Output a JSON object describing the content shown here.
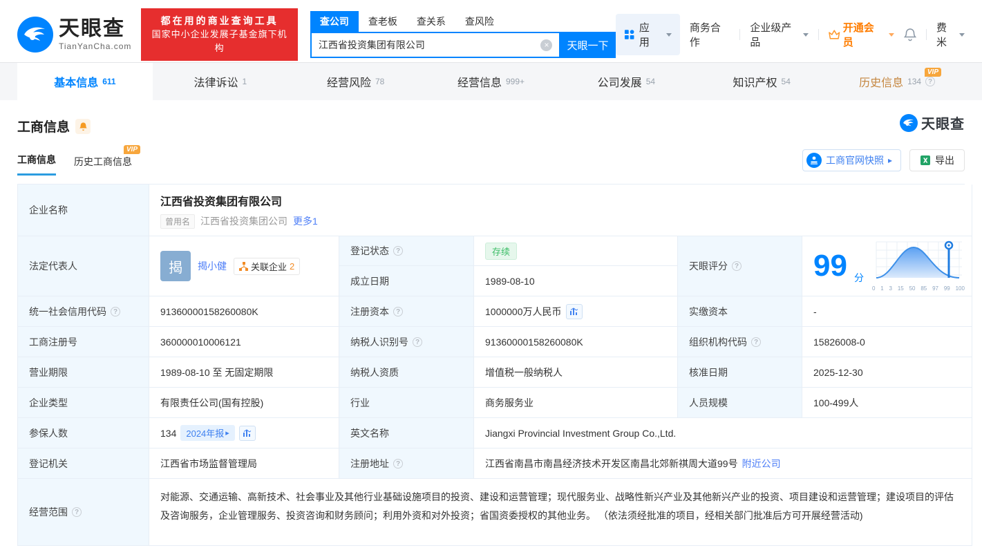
{
  "badges": {
    "vip": "VIP"
  },
  "colors": {
    "brand_blue": "#0084ff",
    "link_blue": "#4d7ef7",
    "member_orange": "#ff7d00",
    "promo_red": "#e62e2e",
    "status_green": "#3dbe68",
    "history_tab_orange": "#c5863f",
    "label_cell_bg": "#f0f8fe"
  },
  "header": {
    "logo": {
      "brand": "天眼查",
      "domain": "TianYanCha.com"
    },
    "promo": {
      "line1": "都在用的商业查询工具",
      "line2": "国家中小企业发展子基金旗下机构"
    },
    "search": {
      "tabs": [
        {
          "label": "查公司"
        },
        {
          "label": "查老板"
        },
        {
          "label": "查关系"
        },
        {
          "label": "查风险"
        }
      ],
      "value": "江西省投资集团有限公司",
      "button": "天眼一下"
    },
    "nav": {
      "apps": "应用",
      "cooperation": "商务合作",
      "enterprise": "企业级产品",
      "member": "开通会员",
      "user": "费米"
    }
  },
  "tabs": [
    {
      "label": "基本信息",
      "count": "611"
    },
    {
      "label": "法律诉讼",
      "count": "1"
    },
    {
      "label": "经营风险",
      "count": "78"
    },
    {
      "label": "经营信息",
      "count": "999+"
    },
    {
      "label": "公司发展",
      "count": "54"
    },
    {
      "label": "知识产权",
      "count": "54"
    },
    {
      "label": "历史信息",
      "count": "134"
    }
  ],
  "section": {
    "title": "工商信息",
    "watermark": "天眼查",
    "subtabs": [
      {
        "label": "工商信息"
      },
      {
        "label": "历史工商信息"
      }
    ],
    "snapshot_button": "工商官网快照",
    "export_button": "导出"
  },
  "table": {
    "company_name": {
      "label": "企业名称",
      "value": "江西省投资集团有限公司",
      "former_label": "曾用名",
      "former_value": "江西省投资集团公司",
      "more_link": "更多1"
    },
    "legal_rep": {
      "label": "法定代表人",
      "avatar_char": "揭",
      "name": "揭小健",
      "related_label": "关联企业",
      "related_count": "2"
    },
    "reg_status": {
      "label": "登记状态",
      "value": "存续"
    },
    "establish_date": {
      "label": "成立日期",
      "value": "1989-08-10"
    },
    "score": {
      "label": "天眼评分",
      "value": "99",
      "unit": "分",
      "axis": [
        "0",
        "1",
        "3",
        "15",
        "50",
        "85",
        "97",
        "99",
        "100"
      ]
    },
    "credit_code": {
      "label": "统一社会信用代码",
      "value": "91360000158260080K"
    },
    "reg_capital": {
      "label": "注册资本",
      "value": "1000000万人民币"
    },
    "paid_capital": {
      "label": "实缴资本",
      "value": "-"
    },
    "reg_number": {
      "label": "工商注册号",
      "value": "360000010006121"
    },
    "taxpayer_id": {
      "label": "纳税人识别号",
      "value": "91360000158260080K"
    },
    "org_code": {
      "label": "组织机构代码",
      "value": "15826008-0"
    },
    "business_term": {
      "label": "营业期限",
      "value": "1989-08-10 至 无固定期限"
    },
    "taxpayer_quality": {
      "label": "纳税人资质",
      "value": "增值税一般纳税人"
    },
    "approve_date": {
      "label": "核准日期",
      "value": "2025-12-30"
    },
    "company_type": {
      "label": "企业类型",
      "value": "有限责任公司(国有控股)"
    },
    "industry": {
      "label": "行业",
      "value": "商务服务业"
    },
    "staff_size": {
      "label": "人员规模",
      "value": "100-499人"
    },
    "insured_count": {
      "label": "参保人数",
      "value": "134",
      "report_badge": "2024年报"
    },
    "english_name": {
      "label": "英文名称",
      "value": "Jiangxi Provincial Investment Group Co.,Ltd."
    },
    "reg_authority": {
      "label": "登记机关",
      "value": "江西省市场监督管理局"
    },
    "reg_address": {
      "label": "注册地址",
      "value": "江西省南昌市南昌经济技术开发区南昌北郊新祺周大道99号",
      "nearby_link": "附近公司"
    },
    "business_scope": {
      "label": "经营范围",
      "value": "对能源、交通运输、高新技术、社会事业及其他行业基础设施项目的投资、建设和运营管理；现代服务业、战略性新兴产业及其他新兴产业的投资、项目建设和运营管理；建设项目的评估及咨询服务，企业管理服务、投资咨询和财务顾问；利用外资和对外投资；省国资委授权的其他业务。 （依法须经批准的项目，经相关部门批准后方可开展经营活动)"
    }
  }
}
